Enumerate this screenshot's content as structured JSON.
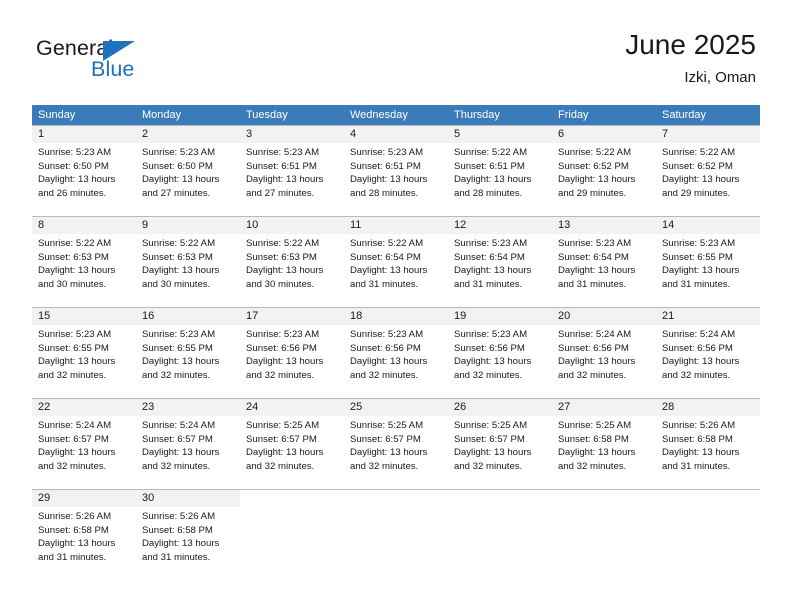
{
  "brand": {
    "name_part1": "General",
    "name_part2": "Blue",
    "triangle_icon": "triangle-icon",
    "accent_color": "#1f72bd"
  },
  "header": {
    "title": "June 2025",
    "subtitle": "Izki, Oman"
  },
  "colors": {
    "header_band": "#3a7cba",
    "day_number_band": "#f2f2f2",
    "grid_line": "#b9b9b9",
    "text": "#1a1a1a"
  },
  "weekdays": [
    "Sunday",
    "Monday",
    "Tuesday",
    "Wednesday",
    "Thursday",
    "Friday",
    "Saturday"
  ],
  "weeks": [
    [
      {
        "day": "1",
        "sunrise": "Sunrise: 5:23 AM",
        "sunset": "Sunset: 6:50 PM",
        "daylight1": "Daylight: 13 hours",
        "daylight2": "and 26 minutes."
      },
      {
        "day": "2",
        "sunrise": "Sunrise: 5:23 AM",
        "sunset": "Sunset: 6:50 PM",
        "daylight1": "Daylight: 13 hours",
        "daylight2": "and 27 minutes."
      },
      {
        "day": "3",
        "sunrise": "Sunrise: 5:23 AM",
        "sunset": "Sunset: 6:51 PM",
        "daylight1": "Daylight: 13 hours",
        "daylight2": "and 27 minutes."
      },
      {
        "day": "4",
        "sunrise": "Sunrise: 5:23 AM",
        "sunset": "Sunset: 6:51 PM",
        "daylight1": "Daylight: 13 hours",
        "daylight2": "and 28 minutes."
      },
      {
        "day": "5",
        "sunrise": "Sunrise: 5:22 AM",
        "sunset": "Sunset: 6:51 PM",
        "daylight1": "Daylight: 13 hours",
        "daylight2": "and 28 minutes."
      },
      {
        "day": "6",
        "sunrise": "Sunrise: 5:22 AM",
        "sunset": "Sunset: 6:52 PM",
        "daylight1": "Daylight: 13 hours",
        "daylight2": "and 29 minutes."
      },
      {
        "day": "7",
        "sunrise": "Sunrise: 5:22 AM",
        "sunset": "Sunset: 6:52 PM",
        "daylight1": "Daylight: 13 hours",
        "daylight2": "and 29 minutes."
      }
    ],
    [
      {
        "day": "8",
        "sunrise": "Sunrise: 5:22 AM",
        "sunset": "Sunset: 6:53 PM",
        "daylight1": "Daylight: 13 hours",
        "daylight2": "and 30 minutes."
      },
      {
        "day": "9",
        "sunrise": "Sunrise: 5:22 AM",
        "sunset": "Sunset: 6:53 PM",
        "daylight1": "Daylight: 13 hours",
        "daylight2": "and 30 minutes."
      },
      {
        "day": "10",
        "sunrise": "Sunrise: 5:22 AM",
        "sunset": "Sunset: 6:53 PM",
        "daylight1": "Daylight: 13 hours",
        "daylight2": "and 30 minutes."
      },
      {
        "day": "11",
        "sunrise": "Sunrise: 5:22 AM",
        "sunset": "Sunset: 6:54 PM",
        "daylight1": "Daylight: 13 hours",
        "daylight2": "and 31 minutes."
      },
      {
        "day": "12",
        "sunrise": "Sunrise: 5:23 AM",
        "sunset": "Sunset: 6:54 PM",
        "daylight1": "Daylight: 13 hours",
        "daylight2": "and 31 minutes."
      },
      {
        "day": "13",
        "sunrise": "Sunrise: 5:23 AM",
        "sunset": "Sunset: 6:54 PM",
        "daylight1": "Daylight: 13 hours",
        "daylight2": "and 31 minutes."
      },
      {
        "day": "14",
        "sunrise": "Sunrise: 5:23 AM",
        "sunset": "Sunset: 6:55 PM",
        "daylight1": "Daylight: 13 hours",
        "daylight2": "and 31 minutes."
      }
    ],
    [
      {
        "day": "15",
        "sunrise": "Sunrise: 5:23 AM",
        "sunset": "Sunset: 6:55 PM",
        "daylight1": "Daylight: 13 hours",
        "daylight2": "and 32 minutes."
      },
      {
        "day": "16",
        "sunrise": "Sunrise: 5:23 AM",
        "sunset": "Sunset: 6:55 PM",
        "daylight1": "Daylight: 13 hours",
        "daylight2": "and 32 minutes."
      },
      {
        "day": "17",
        "sunrise": "Sunrise: 5:23 AM",
        "sunset": "Sunset: 6:56 PM",
        "daylight1": "Daylight: 13 hours",
        "daylight2": "and 32 minutes."
      },
      {
        "day": "18",
        "sunrise": "Sunrise: 5:23 AM",
        "sunset": "Sunset: 6:56 PM",
        "daylight1": "Daylight: 13 hours",
        "daylight2": "and 32 minutes."
      },
      {
        "day": "19",
        "sunrise": "Sunrise: 5:23 AM",
        "sunset": "Sunset: 6:56 PM",
        "daylight1": "Daylight: 13 hours",
        "daylight2": "and 32 minutes."
      },
      {
        "day": "20",
        "sunrise": "Sunrise: 5:24 AM",
        "sunset": "Sunset: 6:56 PM",
        "daylight1": "Daylight: 13 hours",
        "daylight2": "and 32 minutes."
      },
      {
        "day": "21",
        "sunrise": "Sunrise: 5:24 AM",
        "sunset": "Sunset: 6:56 PM",
        "daylight1": "Daylight: 13 hours",
        "daylight2": "and 32 minutes."
      }
    ],
    [
      {
        "day": "22",
        "sunrise": "Sunrise: 5:24 AM",
        "sunset": "Sunset: 6:57 PM",
        "daylight1": "Daylight: 13 hours",
        "daylight2": "and 32 minutes."
      },
      {
        "day": "23",
        "sunrise": "Sunrise: 5:24 AM",
        "sunset": "Sunset: 6:57 PM",
        "daylight1": "Daylight: 13 hours",
        "daylight2": "and 32 minutes."
      },
      {
        "day": "24",
        "sunrise": "Sunrise: 5:25 AM",
        "sunset": "Sunset: 6:57 PM",
        "daylight1": "Daylight: 13 hours",
        "daylight2": "and 32 minutes."
      },
      {
        "day": "25",
        "sunrise": "Sunrise: 5:25 AM",
        "sunset": "Sunset: 6:57 PM",
        "daylight1": "Daylight: 13 hours",
        "daylight2": "and 32 minutes."
      },
      {
        "day": "26",
        "sunrise": "Sunrise: 5:25 AM",
        "sunset": "Sunset: 6:57 PM",
        "daylight1": "Daylight: 13 hours",
        "daylight2": "and 32 minutes."
      },
      {
        "day": "27",
        "sunrise": "Sunrise: 5:25 AM",
        "sunset": "Sunset: 6:58 PM",
        "daylight1": "Daylight: 13 hours",
        "daylight2": "and 32 minutes."
      },
      {
        "day": "28",
        "sunrise": "Sunrise: 5:26 AM",
        "sunset": "Sunset: 6:58 PM",
        "daylight1": "Daylight: 13 hours",
        "daylight2": "and 31 minutes."
      }
    ],
    [
      {
        "day": "29",
        "sunrise": "Sunrise: 5:26 AM",
        "sunset": "Sunset: 6:58 PM",
        "daylight1": "Daylight: 13 hours",
        "daylight2": "and 31 minutes."
      },
      {
        "day": "30",
        "sunrise": "Sunrise: 5:26 AM",
        "sunset": "Sunset: 6:58 PM",
        "daylight1": "Daylight: 13 hours",
        "daylight2": "and 31 minutes."
      },
      {
        "day": "",
        "sunrise": "",
        "sunset": "",
        "daylight1": "",
        "daylight2": ""
      },
      {
        "day": "",
        "sunrise": "",
        "sunset": "",
        "daylight1": "",
        "daylight2": ""
      },
      {
        "day": "",
        "sunrise": "",
        "sunset": "",
        "daylight1": "",
        "daylight2": ""
      },
      {
        "day": "",
        "sunrise": "",
        "sunset": "",
        "daylight1": "",
        "daylight2": ""
      },
      {
        "day": "",
        "sunrise": "",
        "sunset": "",
        "daylight1": "",
        "daylight2": ""
      }
    ]
  ]
}
